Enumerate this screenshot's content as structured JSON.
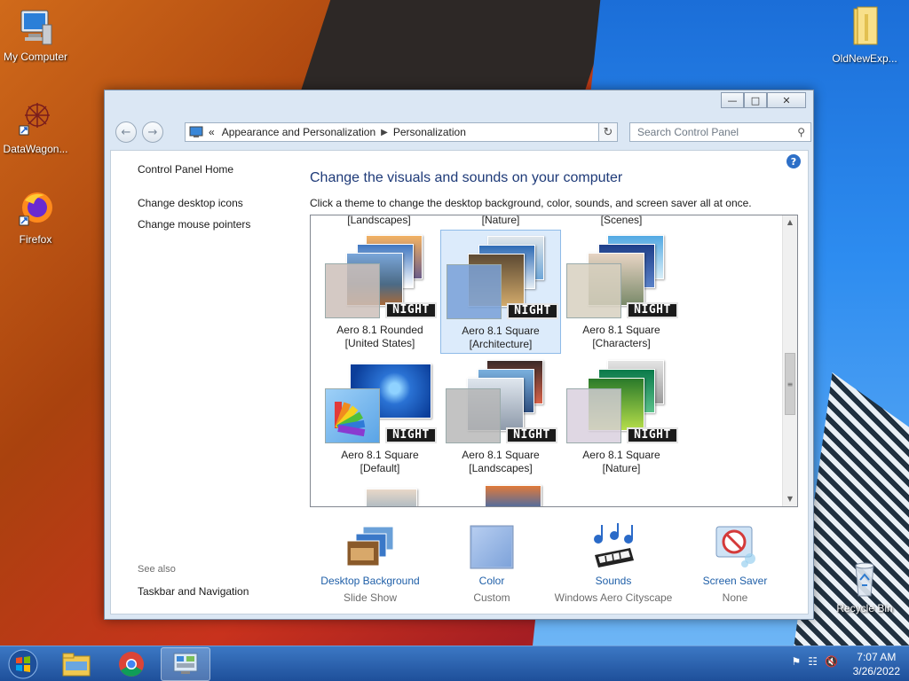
{
  "desktop": {
    "icons": [
      {
        "label": "My Computer",
        "icon": "computer-icon"
      },
      {
        "label": "DataWagon...",
        "icon": "datawagon-icon"
      },
      {
        "label": "Firefox",
        "icon": "firefox-icon"
      },
      {
        "label": "OldNewExp...",
        "icon": "folder-icon"
      },
      {
        "label": "Recycle Bin",
        "icon": "recycle-bin-icon"
      }
    ]
  },
  "window": {
    "address": {
      "crumb_prefix": "«",
      "crumbs": [
        "Appearance and Personalization",
        "Personalization"
      ]
    },
    "search": {
      "placeholder": "Search Control Panel"
    },
    "left_pane": {
      "home": "Control Panel Home",
      "links": [
        "Change desktop icons",
        "Change mouse pointers"
      ],
      "see_also_label": "See also",
      "see_also_links": [
        "Taskbar and Navigation"
      ]
    },
    "main": {
      "title": "Change the visuals and sounds on your computer",
      "subtitle": "Click a theme to change the desktop background, color, sounds, and screen saver all at once.",
      "top_row_labels": [
        "[Landscapes]",
        "[Nature]",
        "[Scenes]"
      ],
      "night_badge": "NIGHT",
      "themes": [
        {
          "line1": "Aero 8.1 Rounded",
          "line2": "[United States]",
          "selected": false
        },
        {
          "line1": "Aero 8.1 Square",
          "line2": "[Architecture]",
          "selected": true
        },
        {
          "line1": "Aero 8.1 Square",
          "line2": "[Characters]",
          "selected": false
        },
        {
          "line1": "Aero 8.1 Square",
          "line2": "[Default]",
          "selected": false
        },
        {
          "line1": "Aero 8.1 Square",
          "line2": "[Landscapes]",
          "selected": false
        },
        {
          "line1": "Aero 8.1 Square",
          "line2": "[Nature]",
          "selected": false
        }
      ]
    },
    "bottom": [
      {
        "label": "Desktop Background",
        "value": "Slide Show",
        "icon": "desktop-background-icon"
      },
      {
        "label": "Color",
        "value": "Custom",
        "icon": "color-icon"
      },
      {
        "label": "Sounds",
        "value": "Windows Aero Cityscape",
        "icon": "sounds-icon"
      },
      {
        "label": "Screen Saver",
        "value": "None",
        "icon": "screen-saver-icon"
      }
    ]
  },
  "taskbar": {
    "time": "7:07 AM",
    "date": "3/26/2022"
  },
  "colors": {
    "link_blue": "#1f5fa8",
    "title_blue": "#1e3a78",
    "selection": "#dcebfb",
    "taskbar": "#2a63ae"
  }
}
